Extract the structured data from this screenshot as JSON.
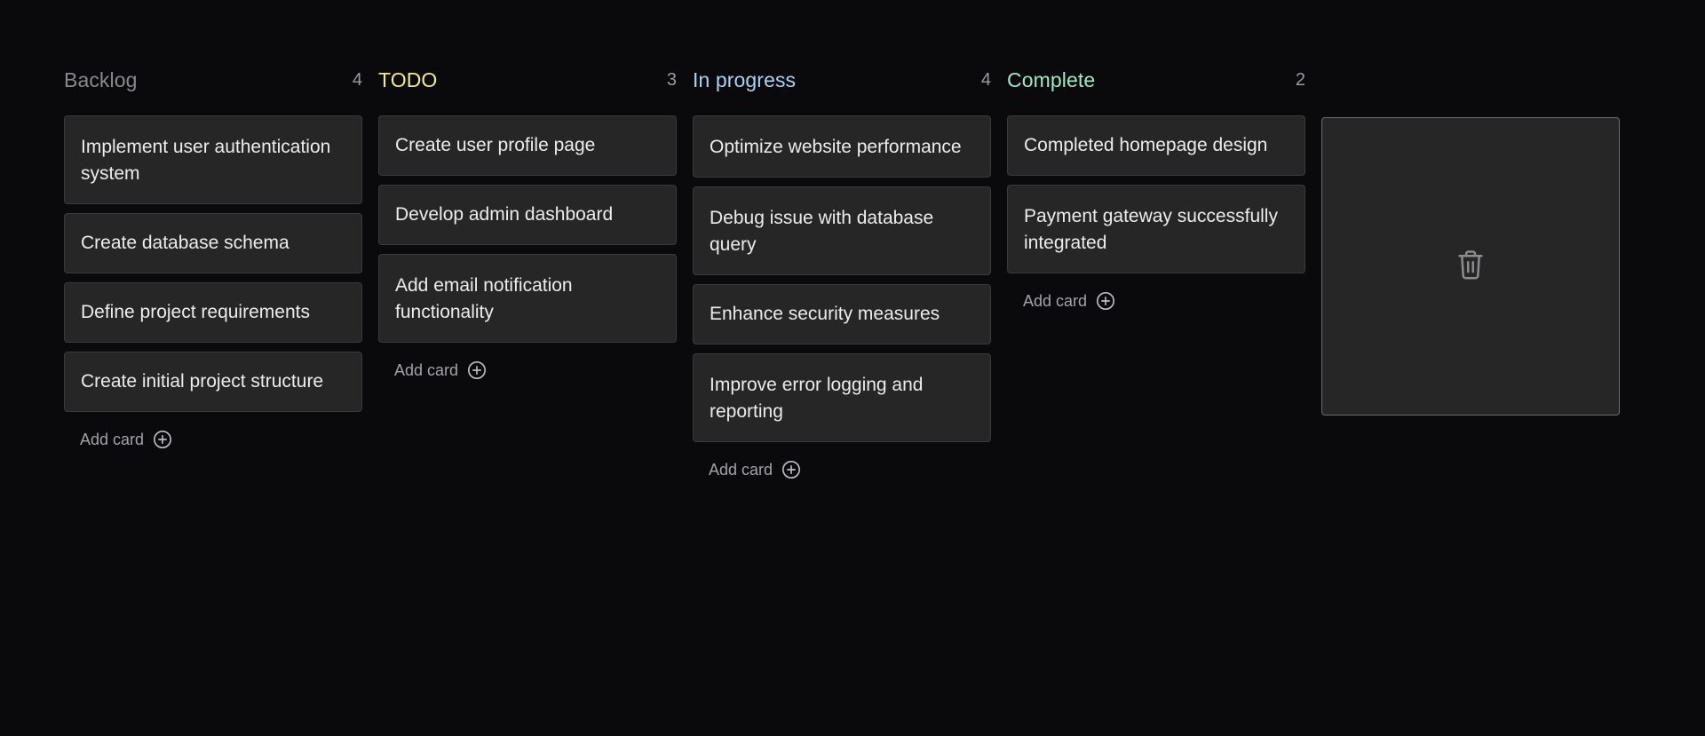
{
  "columns": [
    {
      "title": "Backlog",
      "count": "4",
      "color": "#8a8a8e",
      "cards": [
        "Implement user authentication system",
        "Create database schema",
        "Define project requirements",
        "Create initial project structure"
      ],
      "add_label": "Add card"
    },
    {
      "title": "TODO",
      "count": "3",
      "color": "#f5e88c",
      "cards": [
        "Create user profile page",
        "Develop admin dashboard",
        "Add email notification functionality"
      ],
      "add_label": "Add card"
    },
    {
      "title": "In progress",
      "count": "4",
      "color": "#a9d3f5",
      "cards": [
        "Optimize website performance",
        "Debug issue with database query",
        "Enhance security measures",
        "Improve error logging and reporting"
      ],
      "add_label": "Add card"
    },
    {
      "title": "Complete",
      "count": "2",
      "color": "#9ee8c4",
      "cards": [
        "Completed homepage design",
        "Payment gateway successfully integrated"
      ],
      "add_label": "Add card"
    }
  ],
  "trash": {
    "icon": "trash-icon"
  }
}
